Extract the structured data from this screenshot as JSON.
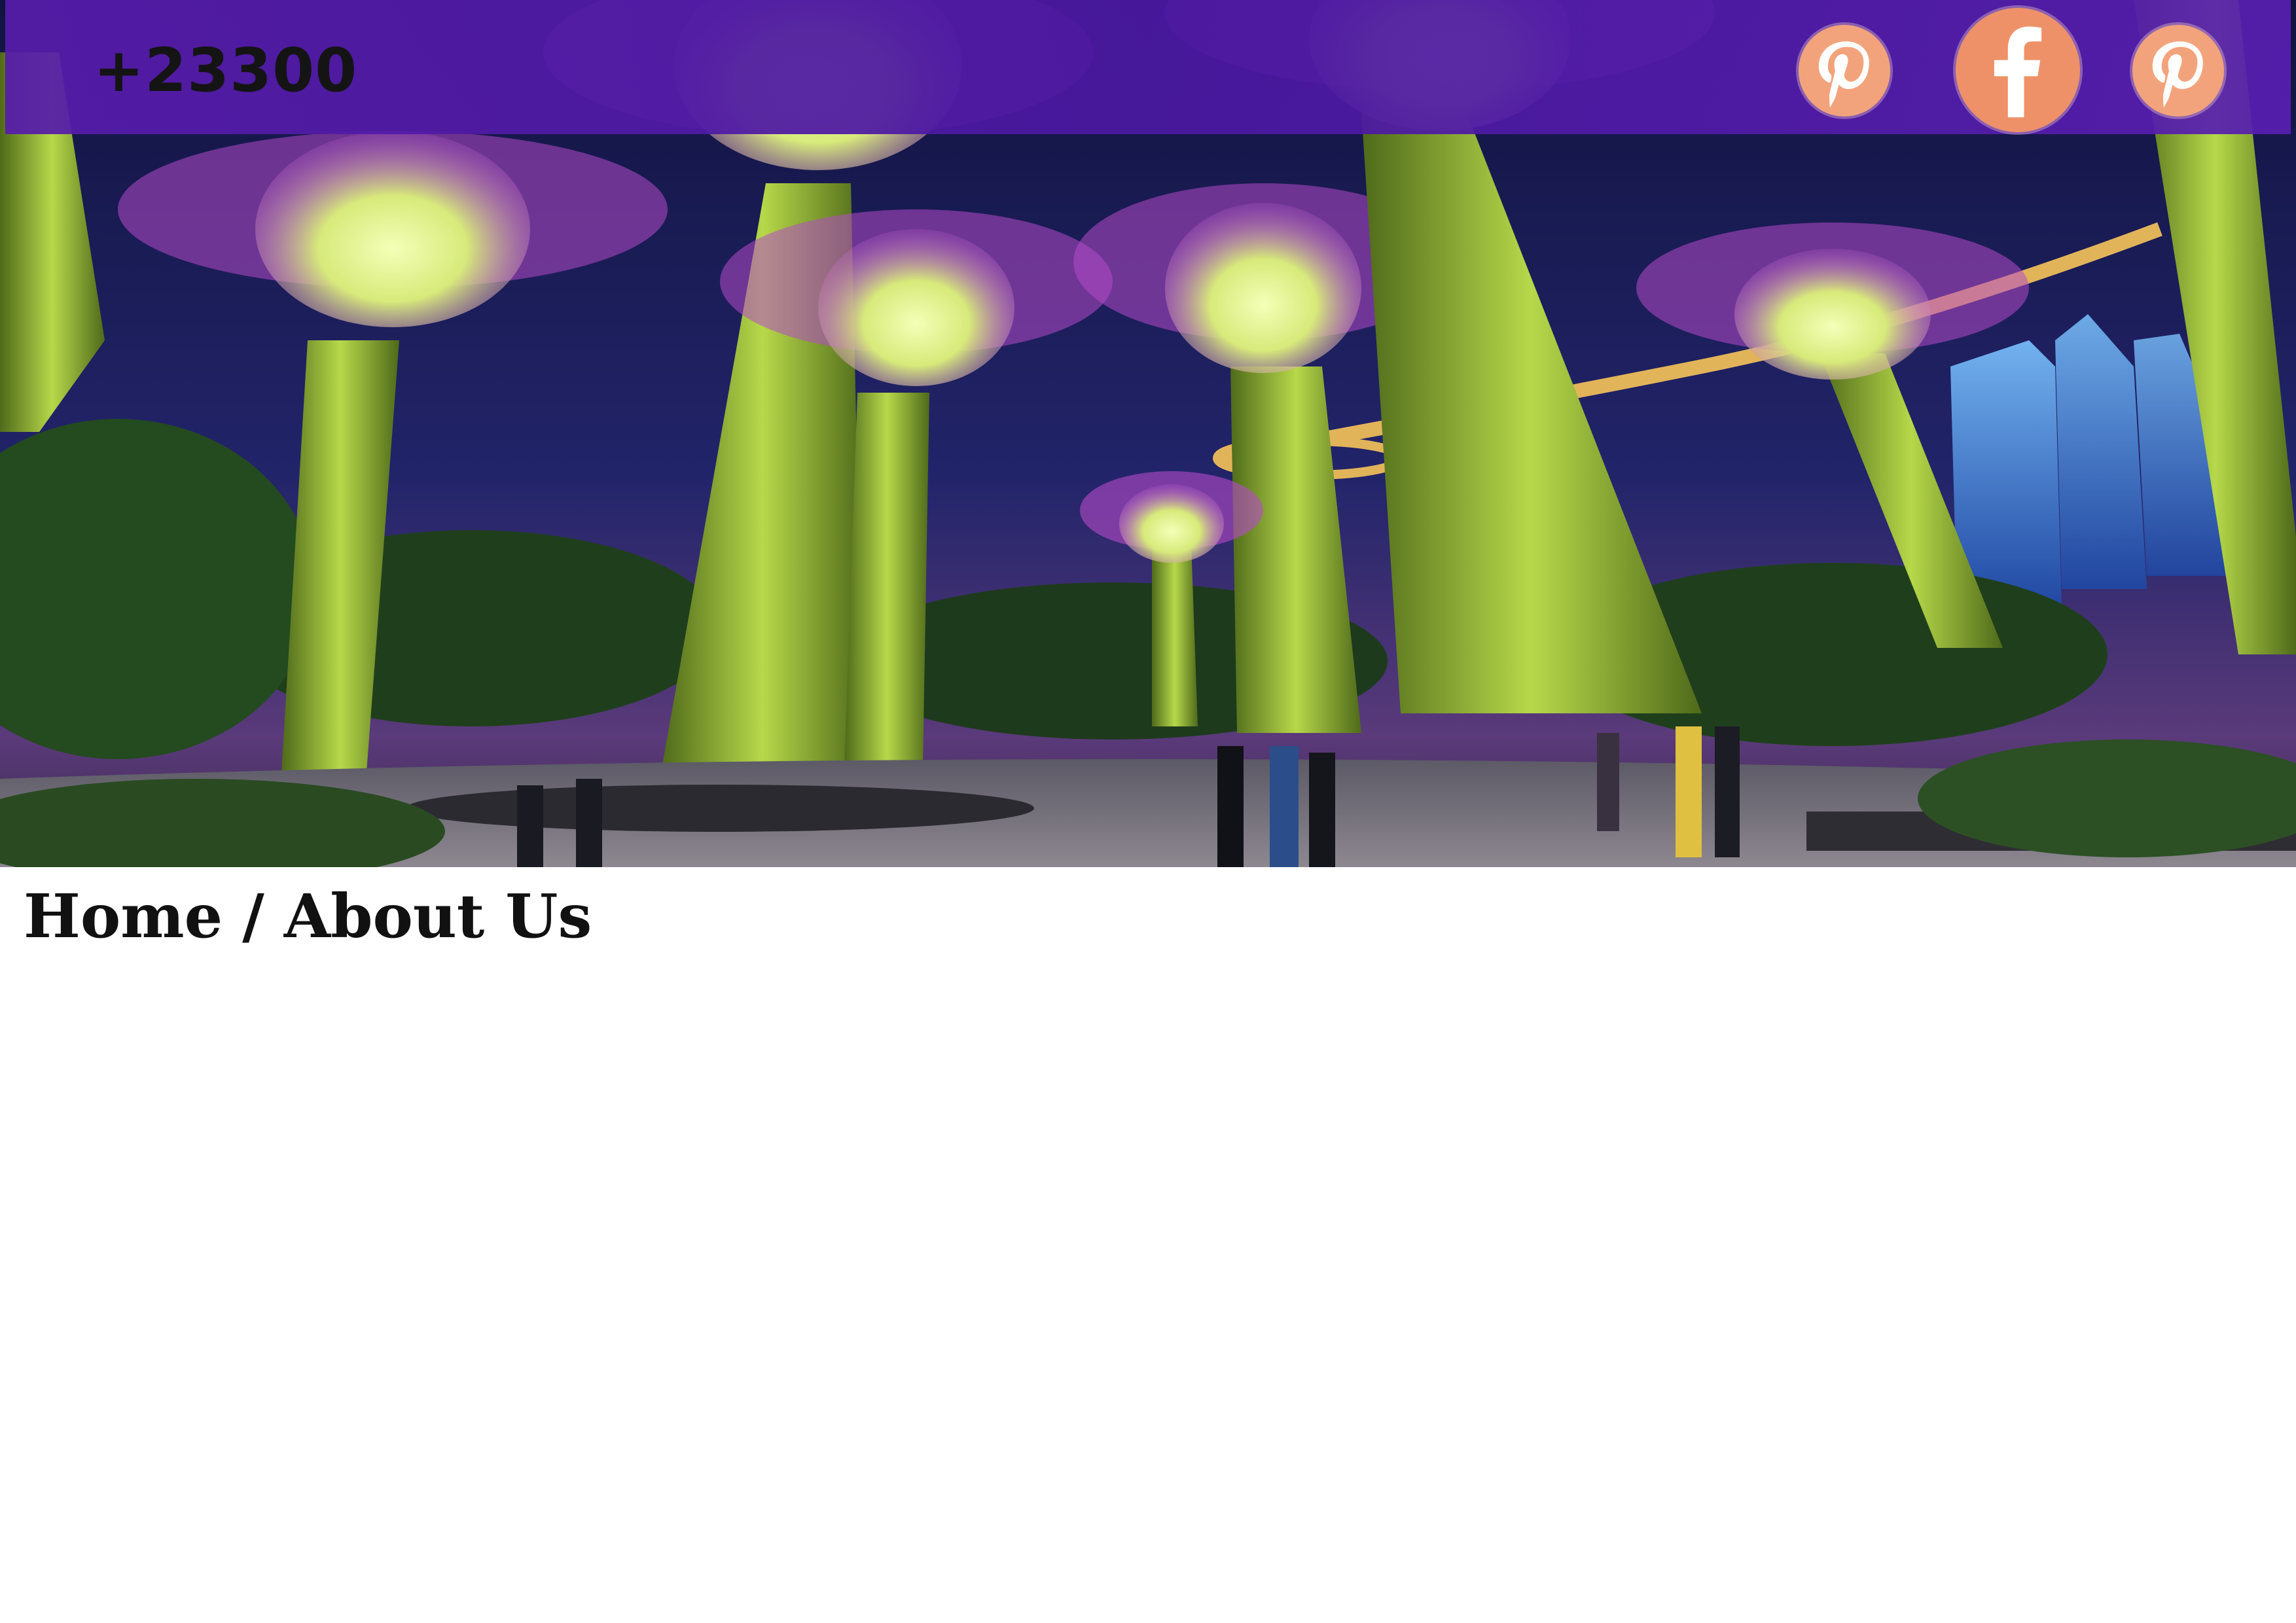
{
  "header": {
    "phone": "+23300",
    "background_color": "#4e1aa6",
    "social_links": [
      {
        "icon": "pinterest-icon",
        "color": "#f3a37b"
      },
      {
        "icon": "facebook-icon",
        "color": "#ee9169"
      },
      {
        "icon": "pinterest-icon",
        "color": "#f3a37b"
      }
    ]
  },
  "hero": {
    "icon": "supertree-grove-photo"
  },
  "breadcrumb": {
    "home": "Home",
    "separator": "/",
    "current": "About Us"
  }
}
